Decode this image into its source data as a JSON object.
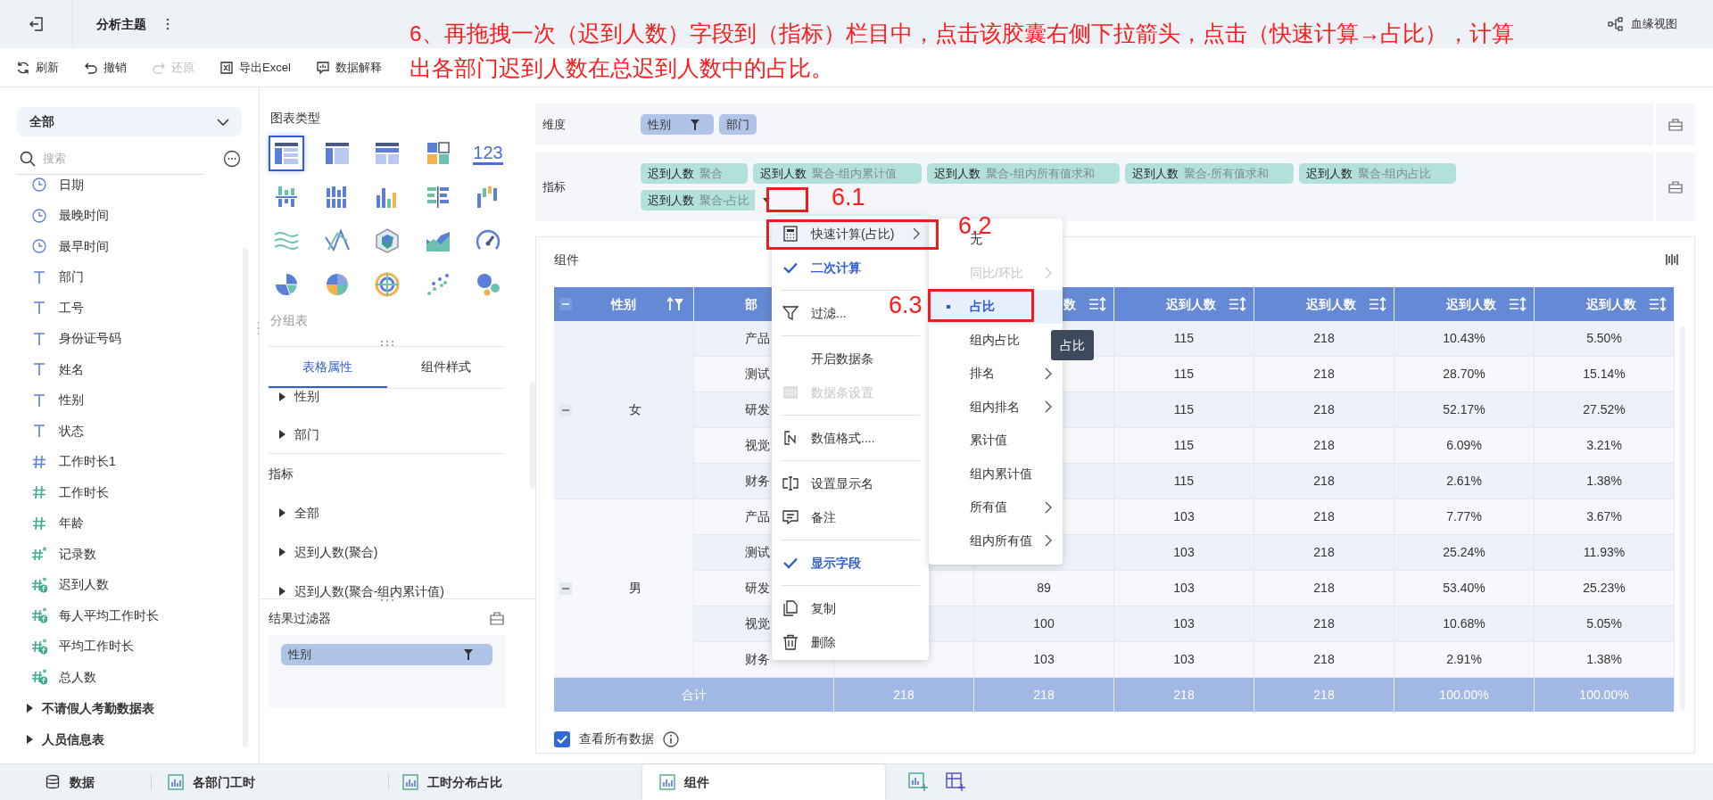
{
  "annotation": {
    "lines": [
      "6、再拖拽一次（迟到人数）字段到（指标）栏目中，点击该胶囊右侧下拉箭头，点击（快速计算→占比），计算",
      "出各部门迟到人数在总迟到人数中的占比。"
    ],
    "step_labels": [
      "6.1",
      "6.2",
      "6.3"
    ]
  },
  "header": {
    "title": "分析主题",
    "lineage_link": "血缘视图"
  },
  "toolbar": [
    {
      "label": "刷新",
      "kind": "refresh",
      "disabled": false
    },
    {
      "label": "撤销",
      "kind": "undo",
      "disabled": false
    },
    {
      "label": "还原",
      "kind": "redo",
      "disabled": true
    },
    {
      "label": "导出Excel",
      "kind": "excel",
      "disabled": false
    },
    {
      "label": "数据解释",
      "kind": "explain",
      "disabled": false
    }
  ],
  "data_panel": {
    "scope": "全部",
    "search_placeholder": "搜索",
    "fields": [
      {
        "label": "日期",
        "kind": "time"
      },
      {
        "label": "最晚时间",
        "kind": "time"
      },
      {
        "label": "最早时间",
        "kind": "time"
      },
      {
        "label": "部门",
        "kind": "text"
      },
      {
        "label": "工号",
        "kind": "text"
      },
      {
        "label": "身份证号码",
        "kind": "text"
      },
      {
        "label": "姓名",
        "kind": "text"
      },
      {
        "label": "性别",
        "kind": "text"
      },
      {
        "label": "状态",
        "kind": "text"
      },
      {
        "label": "工作时长1",
        "kind": "dim_number"
      },
      {
        "label": "工作时长",
        "kind": "number"
      },
      {
        "label": "年龄",
        "kind": "number"
      },
      {
        "label": "记录数",
        "kind": "count"
      },
      {
        "label": "迟到人数",
        "kind": "calc"
      },
      {
        "label": "每人平均工作时长",
        "kind": "calc"
      },
      {
        "label": "平均工作时长",
        "kind": "calc"
      },
      {
        "label": "总人数",
        "kind": "calc"
      }
    ],
    "tables": [
      "不请假人考勤数据表",
      "人员信息表"
    ]
  },
  "chart_types": {
    "title": "图表类型",
    "selected_name": "分组表",
    "types": [
      {
        "kind": "table_grouped",
        "selected": true
      },
      {
        "kind": "table_detail",
        "selected": false
      },
      {
        "kind": "table_cross",
        "selected": false
      },
      {
        "kind": "blocks",
        "selected": false
      },
      {
        "kind": "kpi",
        "selected": false,
        "text": "123"
      },
      {
        "kind": "dot_bars",
        "selected": false
      },
      {
        "kind": "bar_multi",
        "selected": false
      },
      {
        "kind": "column",
        "selected": false
      },
      {
        "kind": "bar_h",
        "selected": false
      },
      {
        "kind": "column_range",
        "selected": false
      },
      {
        "kind": "wave",
        "selected": false
      },
      {
        "kind": "line",
        "selected": false
      },
      {
        "kind": "radar",
        "selected": false
      },
      {
        "kind": "area",
        "selected": false
      },
      {
        "kind": "gauge",
        "selected": false
      },
      {
        "kind": "pie",
        "selected": false
      },
      {
        "kind": "pie_multi",
        "selected": false
      },
      {
        "kind": "radial",
        "selected": false
      },
      {
        "kind": "scatter",
        "selected": false
      },
      {
        "kind": "bubble",
        "selected": false
      }
    ]
  },
  "properties": {
    "tabs": [
      {
        "label": "表格属性",
        "selected": true
      },
      {
        "label": "组件样式",
        "selected": false
      }
    ],
    "dimension_items": [
      "性别",
      "部门"
    ],
    "indicator_heading": "指标",
    "indicator_items": [
      "全部",
      "迟到人数(聚合)",
      "迟到人数(聚合-组内累计值)"
    ]
  },
  "result_filter": {
    "title": "结果过滤器",
    "chips": [
      {
        "label": "性别",
        "filtered": true
      }
    ]
  },
  "shelves": {
    "dimension": {
      "label": "维度",
      "chips": [
        {
          "field": "性别",
          "filtered": true
        },
        {
          "field": "部门",
          "filtered": false
        }
      ]
    },
    "indicator": {
      "label": "指标",
      "chips": [
        {
          "field": "迟到人数",
          "agg": "聚合",
          "dropdown": false
        },
        {
          "field": "迟到人数",
          "agg": "聚合-组内累计值",
          "dropdown": false
        },
        {
          "field": "迟到人数",
          "agg": "聚合-组内所有值求和",
          "dropdown": false
        },
        {
          "field": "迟到人数",
          "agg": "聚合-所有值求和",
          "dropdown": false
        },
        {
          "field": "迟到人数",
          "agg": "聚合-组内占比",
          "dropdown": false
        },
        {
          "field": "迟到人数",
          "agg": "聚合-占比",
          "dropdown": true
        }
      ]
    }
  },
  "component": {
    "title": "组件",
    "table": {
      "columns": [
        {
          "label": "性别",
          "kind": "dimension"
        },
        {
          "label": "部",
          "kind": "dimension"
        },
        {
          "kind": "measure"
        },
        {
          "label": "数",
          "kind": "measure"
        },
        {
          "label": "迟到人数",
          "kind": "measure"
        },
        {
          "label": "迟到人数",
          "kind": "measure"
        },
        {
          "label": "迟到人数",
          "kind": "measure"
        },
        {
          "label": "迟到人数",
          "kind": "measure"
        }
      ],
      "groups": [
        {
          "label": "女",
          "expanded": true,
          "rows": [
            {
              "department": "产品",
              "values": [
                "115",
                "218",
                "10.43%",
                "5.50%"
              ]
            },
            {
              "department": "测试",
              "values": [
                "115",
                "218",
                "28.70%",
                "15.14%"
              ]
            },
            {
              "department": "研发",
              "values": [
                "115",
                "218",
                "52.17%",
                "27.52%"
              ]
            },
            {
              "department": "视觉",
              "values": [
                "115",
                "218",
                "6.09%",
                "3.21%"
              ]
            },
            {
              "department": "财务",
              "values": [
                "115",
                "218",
                "2.61%",
                "1.38%"
              ]
            }
          ]
        },
        {
          "label": "男",
          "expanded": true,
          "rows": [
            {
              "department": "产品",
              "values": [
                "103",
                "218",
                "7.77%",
                "3.67%"
              ]
            },
            {
              "department": "测试",
              "values": [
                "103",
                "218",
                "25.24%",
                "11.93%"
              ]
            },
            {
              "department": "研发",
              "values": [
                "89",
                "103",
                "218",
                "53.40%",
                "25.23%"
              ]
            },
            {
              "department": "视觉",
              "values": [
                "100",
                "103",
                "218",
                "10.68%",
                "5.05%"
              ]
            },
            {
              "department": "财务",
              "values": [
                "103",
                "103",
                "218",
                "2.91%",
                "1.38%"
              ]
            }
          ]
        }
      ],
      "total": {
        "label": "合计",
        "values": [
          "218",
          "218",
          "218",
          "218",
          "100.00%",
          "100.00%"
        ]
      }
    },
    "show_all": {
      "label": "查看所有数据",
      "checked": true
    }
  },
  "context_menu": {
    "items": [
      {
        "kind": "calculator",
        "label": "快速计算(占比)",
        "submenu": true,
        "disabled": false,
        "selected": true
      },
      {
        "kind": "check",
        "label": "二次计算",
        "checked": true,
        "selected": false
      },
      {
        "kind": "separator"
      },
      {
        "kind": "filter",
        "label": "过滤...",
        "submenu": false,
        "disabled": false,
        "selected": false
      },
      {
        "kind": "separator"
      },
      {
        "kind": "plain",
        "label": "开启数据条",
        "submenu": false,
        "disabled": false,
        "selected": false
      },
      {
        "kind": "databar",
        "label": "数据条设置",
        "submenu": false,
        "disabled": true,
        "selected": false
      },
      {
        "kind": "separator"
      },
      {
        "kind": "format",
        "label": "数值格式....",
        "submenu": false,
        "disabled": false,
        "selected": false
      },
      {
        "kind": "separator"
      },
      {
        "kind": "rename",
        "label": "设置显示名",
        "submenu": false,
        "disabled": false,
        "selected": false
      },
      {
        "kind": "note",
        "label": "备注",
        "submenu": false,
        "disabled": false,
        "selected": false
      },
      {
        "kind": "separator"
      },
      {
        "kind": "check",
        "label": "显示字段",
        "checked": true,
        "selected": false
      },
      {
        "kind": "separator"
      },
      {
        "kind": "copy",
        "label": "复制",
        "submenu": false,
        "disabled": false,
        "selected": false
      },
      {
        "kind": "trash",
        "label": "删除",
        "submenu": false,
        "disabled": false,
        "selected": false
      }
    ]
  },
  "submenu": {
    "items": [
      {
        "label": "无",
        "selected": false,
        "disabled": false,
        "submenu": false
      },
      {
        "label": "同比/环比",
        "selected": false,
        "disabled": true,
        "submenu": true
      },
      {
        "label": "占比",
        "selected": true,
        "disabled": false,
        "submenu": false
      },
      {
        "label": "组内占比",
        "selected": false,
        "disabled": false,
        "submenu": false
      },
      {
        "label": "排名",
        "selected": false,
        "disabled": false,
        "submenu": true
      },
      {
        "label": "组内排名",
        "selected": false,
        "disabled": false,
        "submenu": true
      },
      {
        "label": "累计值",
        "selected": false,
        "disabled": false,
        "submenu": false
      },
      {
        "label": "组内累计值",
        "selected": false,
        "disabled": false,
        "submenu": false
      },
      {
        "label": "所有值",
        "selected": false,
        "disabled": false,
        "submenu": true
      },
      {
        "label": "组内所有值",
        "selected": false,
        "disabled": false,
        "submenu": true
      }
    ]
  },
  "tooltip": "占比",
  "bottom_tabs": [
    {
      "label": "数据",
      "kind": "data",
      "selected": false
    },
    {
      "label": "各部门工时",
      "kind": "sheet",
      "selected": false
    },
    {
      "label": "工时分布占比",
      "kind": "sheet",
      "selected": false
    },
    {
      "label": "组件",
      "kind": "sheet",
      "selected": true
    }
  ]
}
